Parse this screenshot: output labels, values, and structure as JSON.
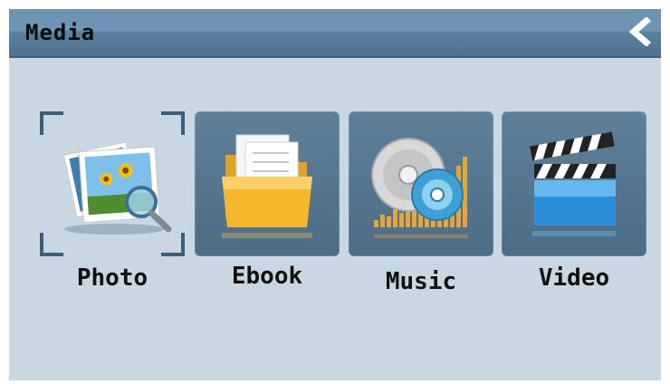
{
  "header": {
    "title": "Media"
  },
  "apps": [
    {
      "label": "Photo",
      "icon": "photo-icon",
      "selected": true
    },
    {
      "label": "Ebook",
      "icon": "folder-icon",
      "selected": false
    },
    {
      "label": "Music",
      "icon": "music-cd-icon",
      "selected": false
    },
    {
      "label": "Video",
      "icon": "clapperboard-icon",
      "selected": false
    }
  ],
  "colors": {
    "background": "#c8d7e2",
    "header": "#5a7f9f",
    "tile": "#557590",
    "selection_bracket": "#3c5e78"
  }
}
